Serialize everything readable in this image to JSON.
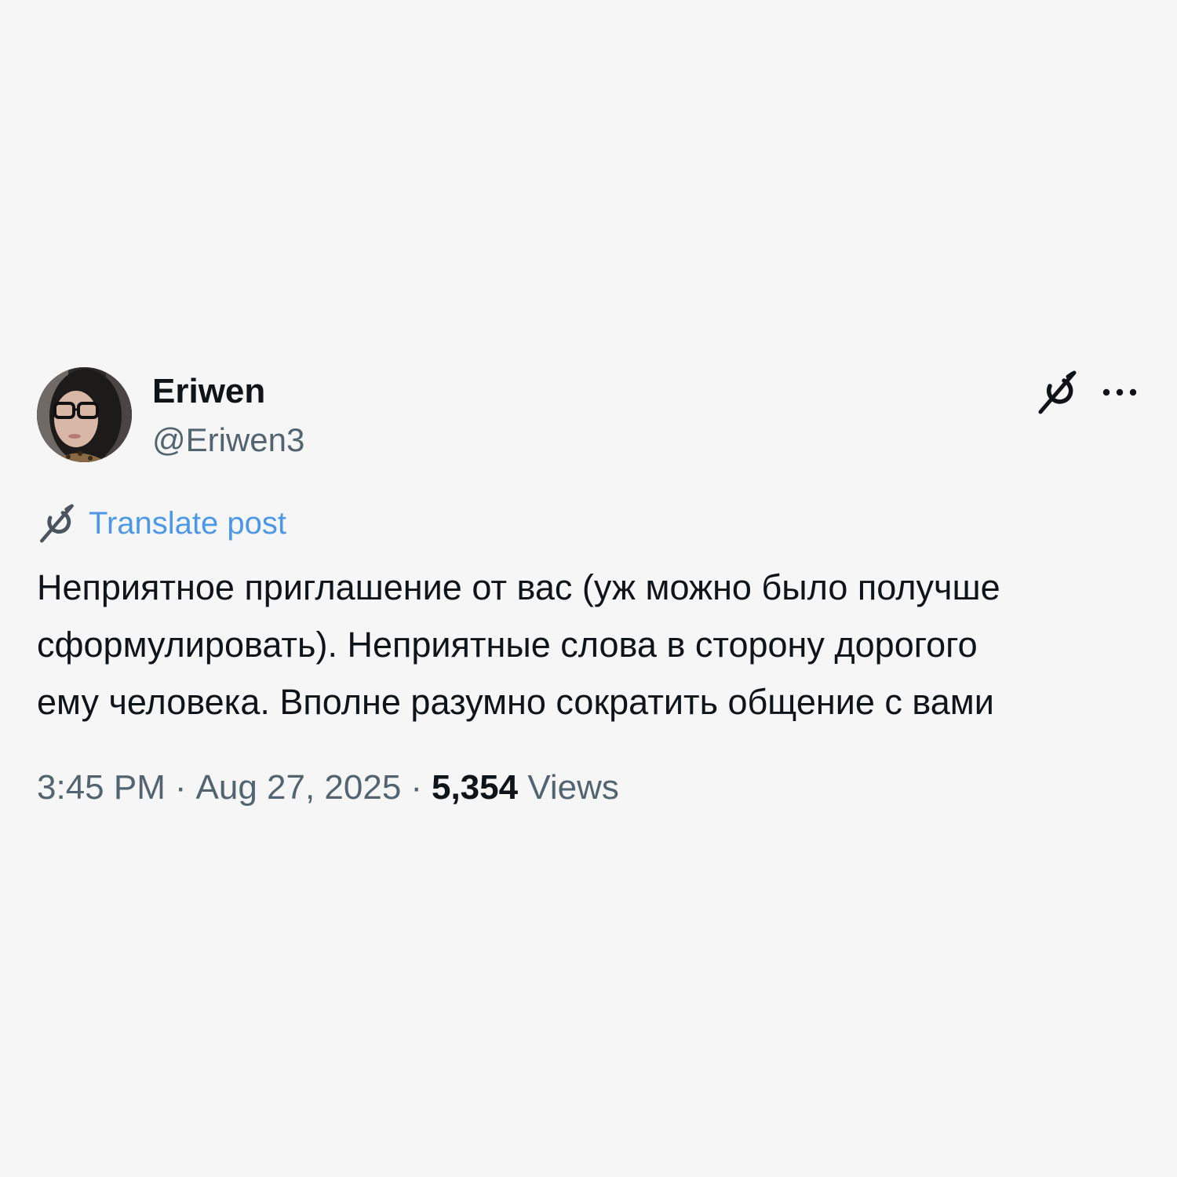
{
  "author": {
    "display_name": "Eriwen",
    "handle": "@Eriwen3",
    "avatar_icon": "profile-photo"
  },
  "actions": {
    "grok_icon": "grok-icon",
    "more_icon": "more-options-icon"
  },
  "translate": {
    "label": "Translate post",
    "icon": "grok-icon"
  },
  "post": {
    "lines": [
      "Неприятное приглашение от вас (уж можно было получше",
      "сформулировать). Неприятные слова в сторону дорогого",
      "ему человека. Вполне разумно сократить общение с вами"
    ]
  },
  "meta": {
    "time": "3:45 PM",
    "separator": "·",
    "date": "Aug 27, 2025",
    "views_count": "5,354",
    "views_label": "Views"
  },
  "colors": {
    "background": "#f6f6f6",
    "text": "#0f1419",
    "secondary": "#536471",
    "link": "#4c98e6"
  }
}
